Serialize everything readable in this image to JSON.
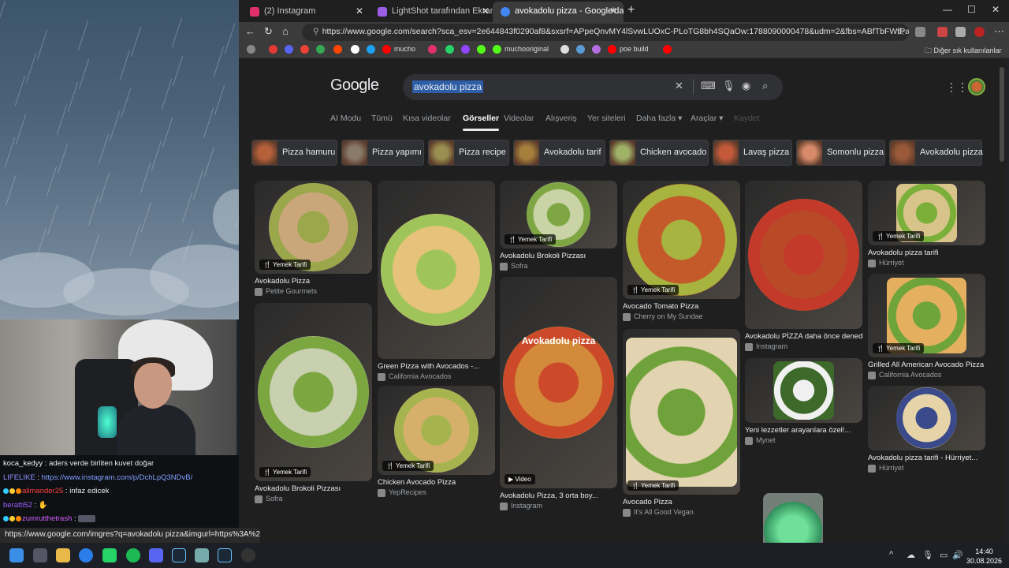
{
  "browser": {
    "tabs": [
      {
        "label": "(2) Instagram",
        "color": "#e1306c"
      },
      {
        "label": "LightShot tarafından Ekran Görünt",
        "color": "#9b5de5"
      },
      {
        "label": "avokadolu pizza - Google'da Ara",
        "color": "#4285f4"
      }
    ],
    "url": "https://www.google.com/search?sca_esv=2e644843f0290af8&sxsrf=APpeQnvMY4lSvwLUOxC-PLoTG8bh4SQaOw:1788090000478&udm=2&fbs=ABfTbFWfPazdQeYYSro3Hgtr2...",
    "bookmarks": [
      {
        "label": "",
        "color": "#888"
      },
      {
        "label": "",
        "color": "#e53935"
      },
      {
        "label": "",
        "color": "#5865f2"
      },
      {
        "label": "",
        "color": "#ea4335"
      },
      {
        "label": "",
        "color": "#34a853"
      },
      {
        "label": "",
        "color": "#ff4500"
      },
      {
        "label": "",
        "color": "#fff"
      },
      {
        "label": "",
        "color": "#1da1f2"
      },
      {
        "label": "mucho",
        "color": "#ff0000"
      },
      {
        "label": "",
        "color": "#e1306c"
      },
      {
        "label": "",
        "color": "#25d366"
      },
      {
        "label": "",
        "color": "#9146ff"
      },
      {
        "label": "",
        "color": "#53fc18"
      },
      {
        "label": "muchooriginal",
        "color": "#53fc18"
      },
      {
        "label": "",
        "color": "#ddd"
      },
      {
        "label": "",
        "color": "#5b9bd5"
      },
      {
        "label": "",
        "color": "#b46ee0"
      },
      {
        "label": "poe build",
        "color": "#ff0000"
      },
      {
        "label": "",
        "color": "#ff0000"
      }
    ],
    "other_bookmarks": "Diğer sık kullanılanlar",
    "status_url": "https://www.google.com/imgres?q=avokadolu pizza&imgurl=https%3A%2..."
  },
  "google": {
    "logo": "Google",
    "query": "avokadolu pizza",
    "tabs": [
      "AI Modu",
      "Tümü",
      "Kısa videolar",
      "Görseller",
      "Videolar",
      "Alışveriş",
      "Yer siteleri",
      "Daha fazla",
      "Araçlar",
      "Kaydet"
    ],
    "active_tab": "Görseller",
    "chips": [
      "Pizza hamuru",
      "Pizza yapımı",
      "Pizza recipe",
      "Avokadolu tarif",
      "Chicken avocado",
      "Lavaş pizza",
      "Somonlu pizza",
      "Avokadolu pizza"
    ],
    "results": [
      {
        "title": "Avokadolu Pizza",
        "source": "Petite Gourmets",
        "tag": "Yemek Tarifi"
      },
      {
        "title": "Avokadolu Brokoli Pizzası",
        "source": "Sofra",
        "tag": "Yemek Tarifi"
      },
      {
        "title": "Green Pizza with Avocados -...",
        "source": "California Avocados",
        "tag": ""
      },
      {
        "title": "Chicken Avocado Pizza",
        "source": "YepRecipes",
        "tag": "Yemek Tarifi"
      },
      {
        "title": "Avokadolu Brokoli Pizzası",
        "source": "Sofra",
        "tag": "Yemek Tarifi"
      },
      {
        "title": "Avokadolu Pizza, 3 orta boy...",
        "source": "Instagram",
        "tag": "Video",
        "overlay": "Avokadolu pizza"
      },
      {
        "title": "Avocado Tomato Pizza",
        "source": "Cherry on My Sundae",
        "tag": "Yemek Tarifi"
      },
      {
        "title": "Avocado Pizza",
        "source": "It's All Good Vegan",
        "tag": "Yemek Tarifi"
      },
      {
        "title": "Avokadolu PİZZA daha önce denedin...",
        "source": "Instagram",
        "tag": ""
      },
      {
        "title": "Yeni lezzetler arayanlara özel!...",
        "source": "Mynet",
        "tag": ""
      },
      {
        "title": "Avokadolu pizza tarifi",
        "source": "Hürriyet",
        "tag": "Yemek Tarifi"
      },
      {
        "title": "Grilled All American Avocado Pizza",
        "source": "California Avocados",
        "tag": "Yemek Tarifi"
      },
      {
        "title": "Avokadolu pizza tarifi - Hürriyet...",
        "source": "Hürriyet",
        "tag": ""
      }
    ]
  },
  "chat": [
    {
      "user": "koca_kedyy",
      "text": " : aders verde birliten kuvet doğar"
    },
    {
      "user": "LIFELIKE",
      "text": " : ",
      "link": "https://www.instagram.com/p/DchLpQ3NDvB/"
    },
    {
      "user": "alimander25",
      "text": " : infaz edicek"
    },
    {
      "user": "beratti52",
      "text": " : "
    },
    {
      "user": "zumrutthetrash",
      "text": " : "
    }
  ],
  "taskbar": {
    "time": "14:40",
    "date": "30.08.2026"
  }
}
